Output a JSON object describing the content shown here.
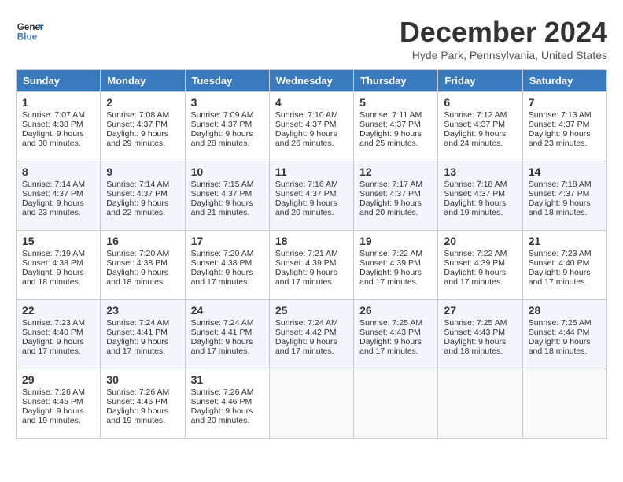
{
  "header": {
    "logo_line1": "General",
    "logo_line2": "Blue",
    "month": "December 2024",
    "location": "Hyde Park, Pennsylvania, United States"
  },
  "days_of_week": [
    "Sunday",
    "Monday",
    "Tuesday",
    "Wednesday",
    "Thursday",
    "Friday",
    "Saturday"
  ],
  "weeks": [
    [
      {
        "day": "1",
        "sunrise": "Sunrise: 7:07 AM",
        "sunset": "Sunset: 4:38 PM",
        "daylight": "Daylight: 9 hours and 30 minutes."
      },
      {
        "day": "2",
        "sunrise": "Sunrise: 7:08 AM",
        "sunset": "Sunset: 4:37 PM",
        "daylight": "Daylight: 9 hours and 29 minutes."
      },
      {
        "day": "3",
        "sunrise": "Sunrise: 7:09 AM",
        "sunset": "Sunset: 4:37 PM",
        "daylight": "Daylight: 9 hours and 28 minutes."
      },
      {
        "day": "4",
        "sunrise": "Sunrise: 7:10 AM",
        "sunset": "Sunset: 4:37 PM",
        "daylight": "Daylight: 9 hours and 26 minutes."
      },
      {
        "day": "5",
        "sunrise": "Sunrise: 7:11 AM",
        "sunset": "Sunset: 4:37 PM",
        "daylight": "Daylight: 9 hours and 25 minutes."
      },
      {
        "day": "6",
        "sunrise": "Sunrise: 7:12 AM",
        "sunset": "Sunset: 4:37 PM",
        "daylight": "Daylight: 9 hours and 24 minutes."
      },
      {
        "day": "7",
        "sunrise": "Sunrise: 7:13 AM",
        "sunset": "Sunset: 4:37 PM",
        "daylight": "Daylight: 9 hours and 23 minutes."
      }
    ],
    [
      {
        "day": "8",
        "sunrise": "Sunrise: 7:14 AM",
        "sunset": "Sunset: 4:37 PM",
        "daylight": "Daylight: 9 hours and 23 minutes."
      },
      {
        "day": "9",
        "sunrise": "Sunrise: 7:14 AM",
        "sunset": "Sunset: 4:37 PM",
        "daylight": "Daylight: 9 hours and 22 minutes."
      },
      {
        "day": "10",
        "sunrise": "Sunrise: 7:15 AM",
        "sunset": "Sunset: 4:37 PM",
        "daylight": "Daylight: 9 hours and 21 minutes."
      },
      {
        "day": "11",
        "sunrise": "Sunrise: 7:16 AM",
        "sunset": "Sunset: 4:37 PM",
        "daylight": "Daylight: 9 hours and 20 minutes."
      },
      {
        "day": "12",
        "sunrise": "Sunrise: 7:17 AM",
        "sunset": "Sunset: 4:37 PM",
        "daylight": "Daylight: 9 hours and 20 minutes."
      },
      {
        "day": "13",
        "sunrise": "Sunrise: 7:18 AM",
        "sunset": "Sunset: 4:37 PM",
        "daylight": "Daylight: 9 hours and 19 minutes."
      },
      {
        "day": "14",
        "sunrise": "Sunrise: 7:18 AM",
        "sunset": "Sunset: 4:37 PM",
        "daylight": "Daylight: 9 hours and 18 minutes."
      }
    ],
    [
      {
        "day": "15",
        "sunrise": "Sunrise: 7:19 AM",
        "sunset": "Sunset: 4:38 PM",
        "daylight": "Daylight: 9 hours and 18 minutes."
      },
      {
        "day": "16",
        "sunrise": "Sunrise: 7:20 AM",
        "sunset": "Sunset: 4:38 PM",
        "daylight": "Daylight: 9 hours and 18 minutes."
      },
      {
        "day": "17",
        "sunrise": "Sunrise: 7:20 AM",
        "sunset": "Sunset: 4:38 PM",
        "daylight": "Daylight: 9 hours and 17 minutes."
      },
      {
        "day": "18",
        "sunrise": "Sunrise: 7:21 AM",
        "sunset": "Sunset: 4:39 PM",
        "daylight": "Daylight: 9 hours and 17 minutes."
      },
      {
        "day": "19",
        "sunrise": "Sunrise: 7:22 AM",
        "sunset": "Sunset: 4:39 PM",
        "daylight": "Daylight: 9 hours and 17 minutes."
      },
      {
        "day": "20",
        "sunrise": "Sunrise: 7:22 AM",
        "sunset": "Sunset: 4:39 PM",
        "daylight": "Daylight: 9 hours and 17 minutes."
      },
      {
        "day": "21",
        "sunrise": "Sunrise: 7:23 AM",
        "sunset": "Sunset: 4:40 PM",
        "daylight": "Daylight: 9 hours and 17 minutes."
      }
    ],
    [
      {
        "day": "22",
        "sunrise": "Sunrise: 7:23 AM",
        "sunset": "Sunset: 4:40 PM",
        "daylight": "Daylight: 9 hours and 17 minutes."
      },
      {
        "day": "23",
        "sunrise": "Sunrise: 7:24 AM",
        "sunset": "Sunset: 4:41 PM",
        "daylight": "Daylight: 9 hours and 17 minutes."
      },
      {
        "day": "24",
        "sunrise": "Sunrise: 7:24 AM",
        "sunset": "Sunset: 4:41 PM",
        "daylight": "Daylight: 9 hours and 17 minutes."
      },
      {
        "day": "25",
        "sunrise": "Sunrise: 7:24 AM",
        "sunset": "Sunset: 4:42 PM",
        "daylight": "Daylight: 9 hours and 17 minutes."
      },
      {
        "day": "26",
        "sunrise": "Sunrise: 7:25 AM",
        "sunset": "Sunset: 4:43 PM",
        "daylight": "Daylight: 9 hours and 17 minutes."
      },
      {
        "day": "27",
        "sunrise": "Sunrise: 7:25 AM",
        "sunset": "Sunset: 4:43 PM",
        "daylight": "Daylight: 9 hours and 18 minutes."
      },
      {
        "day": "28",
        "sunrise": "Sunrise: 7:25 AM",
        "sunset": "Sunset: 4:44 PM",
        "daylight": "Daylight: 9 hours and 18 minutes."
      }
    ],
    [
      {
        "day": "29",
        "sunrise": "Sunrise: 7:26 AM",
        "sunset": "Sunset: 4:45 PM",
        "daylight": "Daylight: 9 hours and 19 minutes."
      },
      {
        "day": "30",
        "sunrise": "Sunrise: 7:26 AM",
        "sunset": "Sunset: 4:46 PM",
        "daylight": "Daylight: 9 hours and 19 minutes."
      },
      {
        "day": "31",
        "sunrise": "Sunrise: 7:26 AM",
        "sunset": "Sunset: 4:46 PM",
        "daylight": "Daylight: 9 hours and 20 minutes."
      },
      null,
      null,
      null,
      null
    ]
  ]
}
